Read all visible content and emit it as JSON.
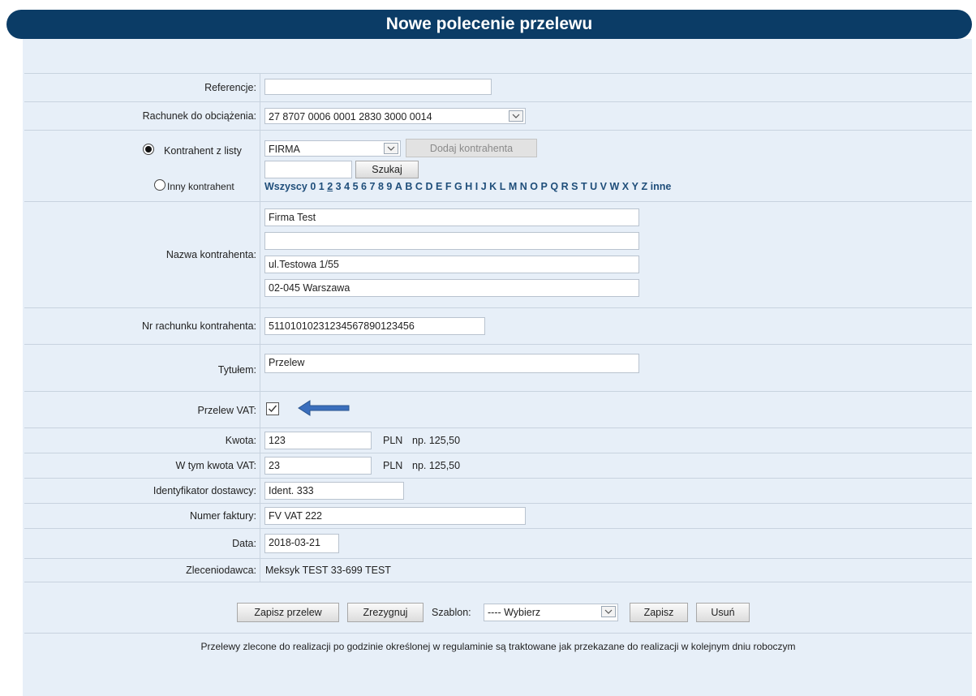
{
  "title": "Nowe polecenie przelewu",
  "fields": {
    "referencje_label": "Referencje:",
    "referencje_value": "",
    "rachunek_label": "Rachunek do obciążenia:",
    "rachunek_value": "27 8707 0006 0001 2830 3000 0014",
    "kontrahent_z_listy_label": "Kontrahent z listy",
    "kontrahent_select_value": "FIRMA",
    "dodaj_kontrahenta": "Dodaj kontrahenta",
    "search_value": "",
    "szukaj": "Szukaj",
    "inny_kontrahent_label": "Inny kontrahent",
    "letters": [
      "Wszyscy",
      "0",
      "1",
      "2",
      "3",
      "4",
      "5",
      "6",
      "7",
      "8",
      "9",
      "A",
      "B",
      "C",
      "D",
      "E",
      "F",
      "G",
      "H",
      "I",
      "J",
      "K",
      "L",
      "M",
      "N",
      "O",
      "P",
      "Q",
      "R",
      "S",
      "T",
      "U",
      "V",
      "W",
      "X",
      "Y",
      "Z",
      "inne"
    ],
    "nazwa_label": "Nazwa kontrahenta:",
    "nazwa_lines": [
      "Firma Test",
      "",
      "ul.Testowa 1/55",
      "02-045 Warszawa"
    ],
    "nr_rachunku_label": "Nr rachunku kontrahenta:",
    "nr_rachunku_value": "51101010231234567890123456",
    "tytul_label": "Tytułem:",
    "tytul_value": "Przelew",
    "vat_label": "Przelew VAT:",
    "vat_checked": true,
    "kwota_label": "Kwota:",
    "kwota_value": "123",
    "kwota_currency": "PLN",
    "kwota_hint": "np. 125,50",
    "kwota_vat_label": "W tym kwota VAT:",
    "kwota_vat_value": "23",
    "kwota_vat_currency": "PLN",
    "kwota_vat_hint": "np. 125,50",
    "identyfikator_label": "Identyfikator dostawcy:",
    "identyfikator_value": "Ident. 333",
    "numer_faktury_label": "Numer faktury:",
    "numer_faktury_value": "FV VAT 222",
    "data_label": "Data:",
    "data_value": "2018-03-21",
    "zleceniodawca_label": "Zleceniodawca:",
    "zleceniodawca_value": "Meksyk TEST 33-699 TEST"
  },
  "actions": {
    "zapisz_przelew": "Zapisz przelew",
    "zrezygnuj": "Zrezygnuj",
    "szablon_label": "Szablon:",
    "szablon_value": "---- Wybierz",
    "zapisz": "Zapisz",
    "usun": "Usuń"
  },
  "footer_note": "Przelewy zlecone do realizacji po godzinie określonej w regulaminie są traktowane jak przekazane do realizacji w kolejnym dniu roboczym",
  "colors": {
    "header": "#0b3c66",
    "panel": "#e7eff8",
    "link": "#1f4e7a",
    "arrow": "#3a6ebd"
  }
}
